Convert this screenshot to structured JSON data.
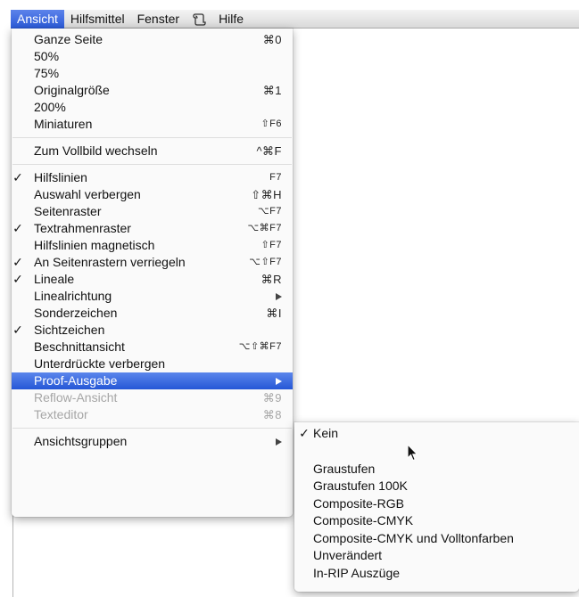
{
  "menubar": {
    "items": [
      "Ansicht",
      "Hilfsmittel",
      "Fenster",
      "Hilfe"
    ],
    "script_icon": "script-icon"
  },
  "menu": {
    "items": [
      {
        "label": "Ganze Seite",
        "shortcut": "⌘0",
        "checked": false
      },
      {
        "label": "50%",
        "shortcut": "",
        "checked": false
      },
      {
        "label": "75%",
        "shortcut": "",
        "checked": false
      },
      {
        "label": "Originalgröße",
        "shortcut": "⌘1",
        "checked": false
      },
      {
        "label": "200%",
        "shortcut": "",
        "checked": false
      },
      {
        "label": "Miniaturen",
        "shortcut": "⇧F6",
        "checked": false
      },
      {
        "label": "Zum Vollbild wechseln",
        "shortcut": "^⌘F",
        "checked": false
      },
      {
        "label": "Hilfslinien",
        "shortcut": "F7",
        "checked": true
      },
      {
        "label": "Auswahl verbergen",
        "shortcut": "⇧⌘H",
        "checked": false
      },
      {
        "label": "Seitenraster",
        "shortcut": "⌥F7",
        "checked": false
      },
      {
        "label": "Textrahmenraster",
        "shortcut": "⌥⌘F7",
        "checked": true
      },
      {
        "label": "Hilfslinien magnetisch",
        "shortcut": "⇧F7",
        "checked": false
      },
      {
        "label": "An Seitenrastern verriegeln",
        "shortcut": "⌥⇧F7",
        "checked": true
      },
      {
        "label": "Lineale",
        "shortcut": "⌘R",
        "checked": true
      },
      {
        "label": "Linealrichtung",
        "shortcut": "",
        "checked": false
      },
      {
        "label": "Sonderzeichen",
        "shortcut": "⌘I",
        "checked": false
      },
      {
        "label": "Sichtzeichen",
        "shortcut": "",
        "checked": true
      },
      {
        "label": "Beschnittansicht",
        "shortcut": "⌥⇧⌘F7",
        "checked": false
      },
      {
        "label": "Unterdrückte verbergen",
        "shortcut": "",
        "checked": false
      },
      {
        "label": "Proof-Ausgabe",
        "shortcut": "",
        "checked": false
      },
      {
        "label": "Reflow-Ansicht",
        "shortcut": "⌘9",
        "checked": false
      },
      {
        "label": "Texteditor",
        "shortcut": "⌘8",
        "checked": false
      },
      {
        "label": "Ansichtsgruppen",
        "shortcut": "",
        "checked": false
      }
    ],
    "check_mark": "✓"
  },
  "submenu": {
    "items": [
      {
        "label": "Kein",
        "checked": true
      },
      {
        "label": "Graustufen",
        "checked": false
      },
      {
        "label": "Graustufen 100K",
        "checked": false
      },
      {
        "label": "Composite-RGB",
        "checked": false
      },
      {
        "label": "Composite-CMYK",
        "checked": false
      },
      {
        "label": "Composite-CMYK und Volltonfarben",
        "checked": false
      },
      {
        "label": "Unverändert",
        "checked": false
      },
      {
        "label": "In-RIP Auszüge",
        "checked": false
      }
    ]
  },
  "colors": {
    "highlight": "#2a5ad8",
    "disabled": "#a6a6a6"
  }
}
